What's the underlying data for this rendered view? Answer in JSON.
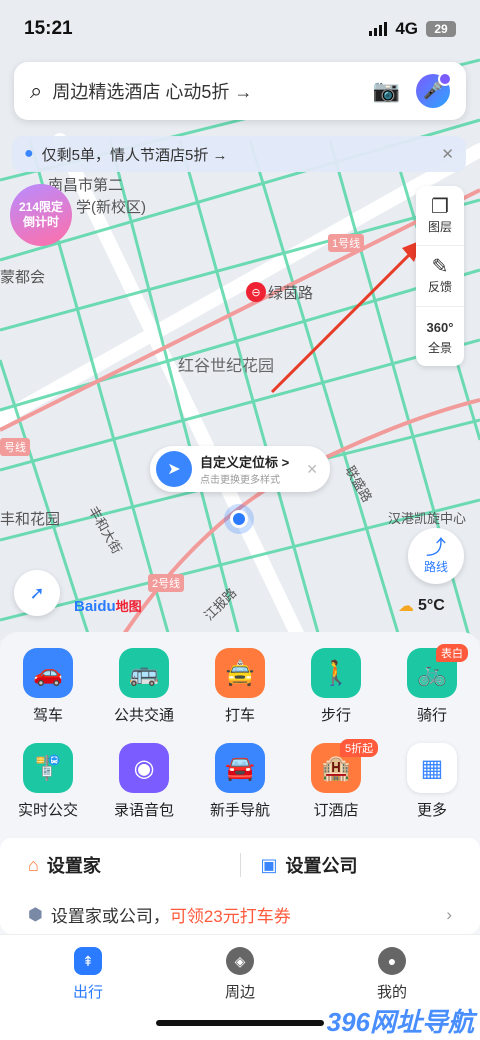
{
  "status_bar": {
    "time": "15:21",
    "network": "4G",
    "battery": "29"
  },
  "search": {
    "text": "周边精选酒店 心动5折 →"
  },
  "banner": {
    "text": "仅剩5单，情人节酒店5折 →"
  },
  "promo_badge": {
    "line1": "214限定",
    "line2": "倒计时"
  },
  "map_tools": [
    {
      "label": "图层",
      "icon": "layers-icon"
    },
    {
      "label": "反馈",
      "icon": "feedback-icon"
    },
    {
      "label": "全景",
      "icon": "panorama-icon",
      "glyph": "360°"
    }
  ],
  "map_labels": {
    "school1": "南昌市第二",
    "school2": "学(新校区)",
    "community": "蒙都会",
    "metro_station": "绿茵路",
    "garden": "红谷世纪花园",
    "line1": "1号线",
    "line2": "2号线",
    "line_left": "号线",
    "east_garden": "丰和花园",
    "road1": "丰和大街",
    "road2": "江报路",
    "road3": "联盛路",
    "kaixuan": "汉港凯旋中心"
  },
  "custom_marker": {
    "title": "自定义定位标 >",
    "subtitle": "点击更换更多样式"
  },
  "route_button": {
    "label": "路线"
  },
  "logo": {
    "brand1": "Bai",
    "brand2": "du",
    "brand3": "地图"
  },
  "weather": {
    "temp": "5°C"
  },
  "services": [
    {
      "label": "驾车",
      "icon": "car-icon",
      "color": "#3a86ff",
      "glyph": "🚗"
    },
    {
      "label": "公共交通",
      "icon": "bus-icon",
      "color": "#1cc8a3",
      "glyph": "🚌"
    },
    {
      "label": "打车",
      "icon": "taxi-icon",
      "color": "#ff7a3c",
      "glyph": "🚖"
    },
    {
      "label": "步行",
      "icon": "walk-icon",
      "color": "#1cc8a3",
      "glyph": "🚶"
    },
    {
      "label": "骑行",
      "icon": "bike-icon",
      "color": "#1cc8a3",
      "glyph": "🚲",
      "tag": "表白"
    },
    {
      "label": "实时公交",
      "icon": "realtime-bus-icon",
      "color": "#1cc8a3",
      "glyph": "🚏"
    },
    {
      "label": "录语音包",
      "icon": "voice-pack-icon",
      "color": "#7a5cff",
      "glyph": "◉"
    },
    {
      "label": "新手导航",
      "icon": "newbie-nav-icon",
      "color": "#3a86ff",
      "glyph": "🚘"
    },
    {
      "label": "订酒店",
      "icon": "hotel-icon",
      "color": "#ff7a3c",
      "glyph": "🏨",
      "tag": "5折起"
    },
    {
      "label": "更多",
      "icon": "more-icon",
      "color": "#ffffff",
      "glyph": "▦"
    }
  ],
  "home": {
    "set_home": "设置家",
    "set_company": "设置公司",
    "sub_text": "设置家或公司，",
    "sub_red": "可领23元打车券"
  },
  "tabs": [
    {
      "label": "出行",
      "icon": "travel-icon",
      "active": true
    },
    {
      "label": "周边",
      "icon": "nearby-icon",
      "active": false
    },
    {
      "label": "我的",
      "icon": "profile-icon",
      "active": false
    }
  ],
  "watermark": "396网址导航"
}
